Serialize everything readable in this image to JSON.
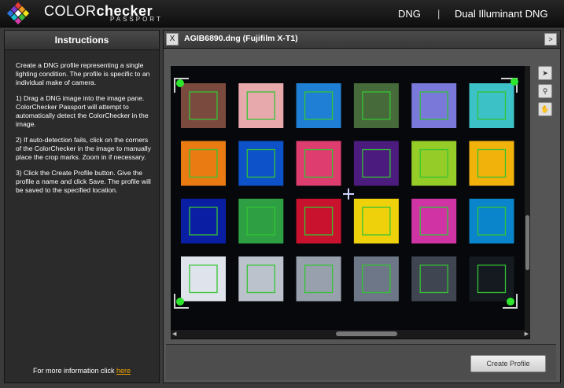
{
  "header": {
    "logo_icon": "colorchecker-logo-icon",
    "brand_part1": "COLOR",
    "brand_part2": "checker",
    "brand_sub": "PASSPORT",
    "mode_dng": "DNG",
    "mode_sep": "|",
    "mode_dual": "Dual Illuminant DNG"
  },
  "instructions": {
    "title": "Instructions",
    "p1": "Create a DNG profile representing a single lighting condition. The profile is specific to an individual make of camera.",
    "p2": "1) Drag a DNG image into the image pane. ColorChecker Passport will attempt to automatically detect the ColorChecker in the image.",
    "p3": "2) If auto-detection fails, click on the corners of the ColorChecker in the image to manually place the crop marks. Zoom in if necessary.",
    "p4": "3) Click the Create Profile button. Give the profile a name and click Save. The profile will be saved to the specified location.",
    "more_text": "For more information click ",
    "more_link": "here"
  },
  "image_panel": {
    "close_label": "X",
    "file_title": "AGIB6890.dng (Fujifilm X-T1)",
    "expand_label": ">",
    "tools": [
      "arrow-tool-icon",
      "zoom-tool-icon",
      "hand-tool-icon"
    ]
  },
  "create_button": "Create Profile",
  "colors": {
    "accent_link": "#f0a400",
    "detect_square": "#35c435",
    "corner_marker": "#2ee62e"
  },
  "patches": [
    [
      "#7b4a3f",
      "#e8a9ad",
      "#1e7fd4",
      "#476a3a",
      "#7a78d9",
      "#3cc1c6"
    ],
    [
      "#e97b12",
      "#0d52c9",
      "#de3d70",
      "#4b1c7e",
      "#96cc27",
      "#f1b20b"
    ],
    [
      "#0a1ea3",
      "#2ea043",
      "#c9122d",
      "#eed10a",
      "#d034a4",
      "#0a84cb"
    ],
    [
      "#dfe4ec",
      "#bcc2cc",
      "#98a0ad",
      "#6e7787",
      "#3f4652",
      "#141a1f"
    ]
  ]
}
